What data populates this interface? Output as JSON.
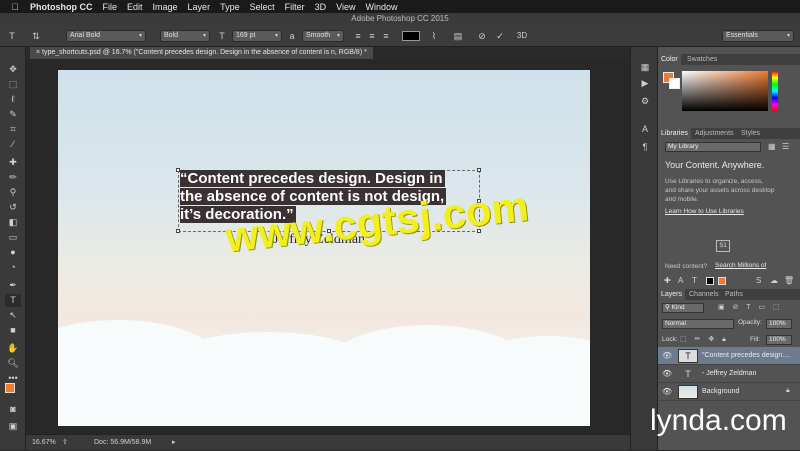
{
  "menubar": {
    "apple": "",
    "app_name": "Photoshop CC",
    "items": [
      "File",
      "Edit",
      "Image",
      "Layer",
      "Type",
      "Select",
      "Filter",
      "3D",
      "View",
      "Window"
    ]
  },
  "window": {
    "title": "Adobe Photoshop CC 2015"
  },
  "options": {
    "font_family": "Arial Bold",
    "font_style": "Bold",
    "font_size": "169 pt",
    "antialias_label": "a",
    "antialias": "Smooth",
    "workspace": "Essentials"
  },
  "document": {
    "tab_label": "type_shortcuts.psd @ 16.7% (\"Content precedes design. Design in the absence of content is n, RGB/8) *",
    "quote_lines": [
      "“Content precedes design. Design in",
      "the absence of content is not design,",
      "it’s decoration.”"
    ],
    "author": "- Jeffrey Zeldman",
    "watermark": "www.cgtsj.com"
  },
  "status": {
    "zoom": "16.67%",
    "doc": "Doc: 56.9M/58.9M"
  },
  "color_panel": {
    "tabs": [
      "Color",
      "Swatches"
    ],
    "fg": "#f07a30",
    "bg": "#ffffff"
  },
  "libraries_panel": {
    "tabs": [
      "Libraries",
      "Adjustments",
      "Styles"
    ],
    "library": "My Library",
    "heading": "Your Content. Anywhere.",
    "body_lines": [
      "Use Libraries to organize, access,",
      "and share your assets across desktop",
      "and mobile."
    ],
    "link": "Learn How to Use Libraries",
    "badge": "S1",
    "need_content": "Need content?",
    "search_link": "Search Millions of"
  },
  "layers_panel": {
    "tabs": [
      "Layers",
      "Channels",
      "Paths"
    ],
    "kind": "Kind",
    "blend": "Normal",
    "opacity_label": "Opacity:",
    "opacity": "100%",
    "lock_label": "Lock:",
    "fill_label": "Fill:",
    "fill": "100%",
    "layers": [
      {
        "name": "\"Content precedes design....",
        "thumb": "T"
      },
      {
        "name": "- Jeffrey Zeldman",
        "thumb": "T"
      },
      {
        "name": "Background",
        "thumb": ""
      }
    ]
  },
  "branding": {
    "logo": "lynda.com"
  }
}
